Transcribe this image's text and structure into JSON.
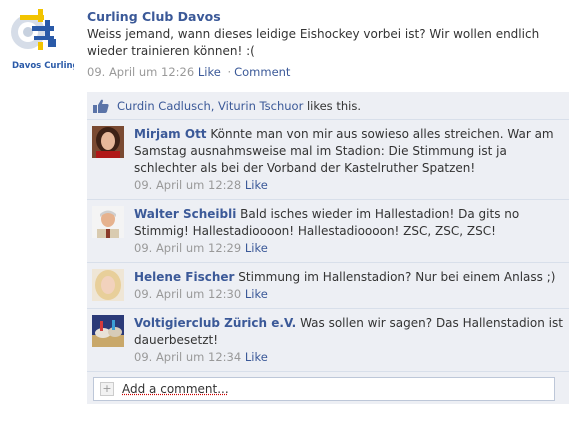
{
  "post": {
    "author": "Curling Club Davos",
    "logo_text": "Davos Curling Club",
    "message": "Weiss jemand, wann dieses leidige Eishockey vorbei ist? Wir wollen endlich wieder trainieren können! :(",
    "timestamp": "09. April um 12:26",
    "like_label": "Like",
    "separator": "·",
    "comment_label": "Comment"
  },
  "likes": {
    "names": "Curdin Cadlusch, Viturin Tschuor",
    "suffix": " likes this."
  },
  "comments": [
    {
      "author": "Mirjam Ott",
      "text": " Könnte man von mir aus sowieso alles streichen. War am Samstag ausnahmsweise mal im Stadion: Die Stimmung ist ja schlechter als bei der Vorband der Kastelruther Spatzen!",
      "timestamp": "09. April um 12:28",
      "like_label": "Like"
    },
    {
      "author": "Walter Scheibli",
      "text": " Bald isches wieder im Hallestadion! Da gits no Stimmig! Hallestadioooon! Hallestadioooon! ZSC, ZSC, ZSC!",
      "timestamp": "09. April um 12:29",
      "like_label": "Like"
    },
    {
      "author": "Helene Fischer",
      "text": " Stimmung im Hallenstadion? Nur bei einem Anlass ;)",
      "timestamp": "09. April um 12:30",
      "like_label": "Like"
    },
    {
      "author": "Voltigierclub Zürich e.V.",
      "text": " Was sollen wir sagen? Das Hallenstadion ist dauerbesetzt!",
      "timestamp": "09. April um 12:34",
      "like_label": "Like"
    }
  ],
  "add_comment": {
    "placeholder": "Add a comment..."
  },
  "colors": {
    "link": "#3b5998",
    "box_bg": "#edeff4",
    "border": "#d8dfea",
    "meta": "#999999"
  }
}
